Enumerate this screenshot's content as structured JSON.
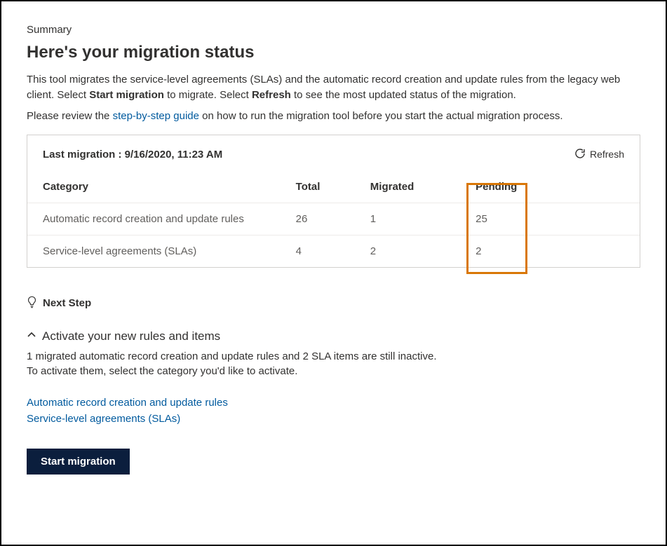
{
  "summary_label": "Summary",
  "page_title": "Here's your migration status",
  "intro_part1": "This tool migrates the service-level agreements (SLAs) and the automatic record creation and update rules from the legacy web client. Select ",
  "intro_bold1": "Start migration",
  "intro_part2": " to migrate. Select ",
  "intro_bold2": "Refresh",
  "intro_part3": " to see the most updated status of the migration.",
  "guide_part1": "Please review the ",
  "guide_link": "step-by-step guide",
  "guide_part2": " on how to run the migration tool before you start the actual migration process.",
  "panel": {
    "last_migration_label": "Last migration : 9/16/2020, 11:23 AM",
    "refresh_label": "Refresh",
    "columns": {
      "category": "Category",
      "total": "Total",
      "migrated": "Migrated",
      "pending": "Pending"
    },
    "rows": [
      {
        "category": "Automatic record creation and update rules",
        "total": "26",
        "migrated": "1",
        "pending": "25"
      },
      {
        "category": "Service-level agreements (SLAs)",
        "total": "4",
        "migrated": "2",
        "pending": "2"
      }
    ]
  },
  "next_step_label": "Next Step",
  "activate": {
    "header": "Activate your new rules and items",
    "body_line1": "1 migrated automatic record creation and update rules and 2 SLA items are still inactive.",
    "body_line2": "To activate them, select the category you'd like to activate.",
    "link1": "Automatic record creation and update rules",
    "link2": "Service-level agreements (SLAs)"
  },
  "start_button_label": "Start migration"
}
